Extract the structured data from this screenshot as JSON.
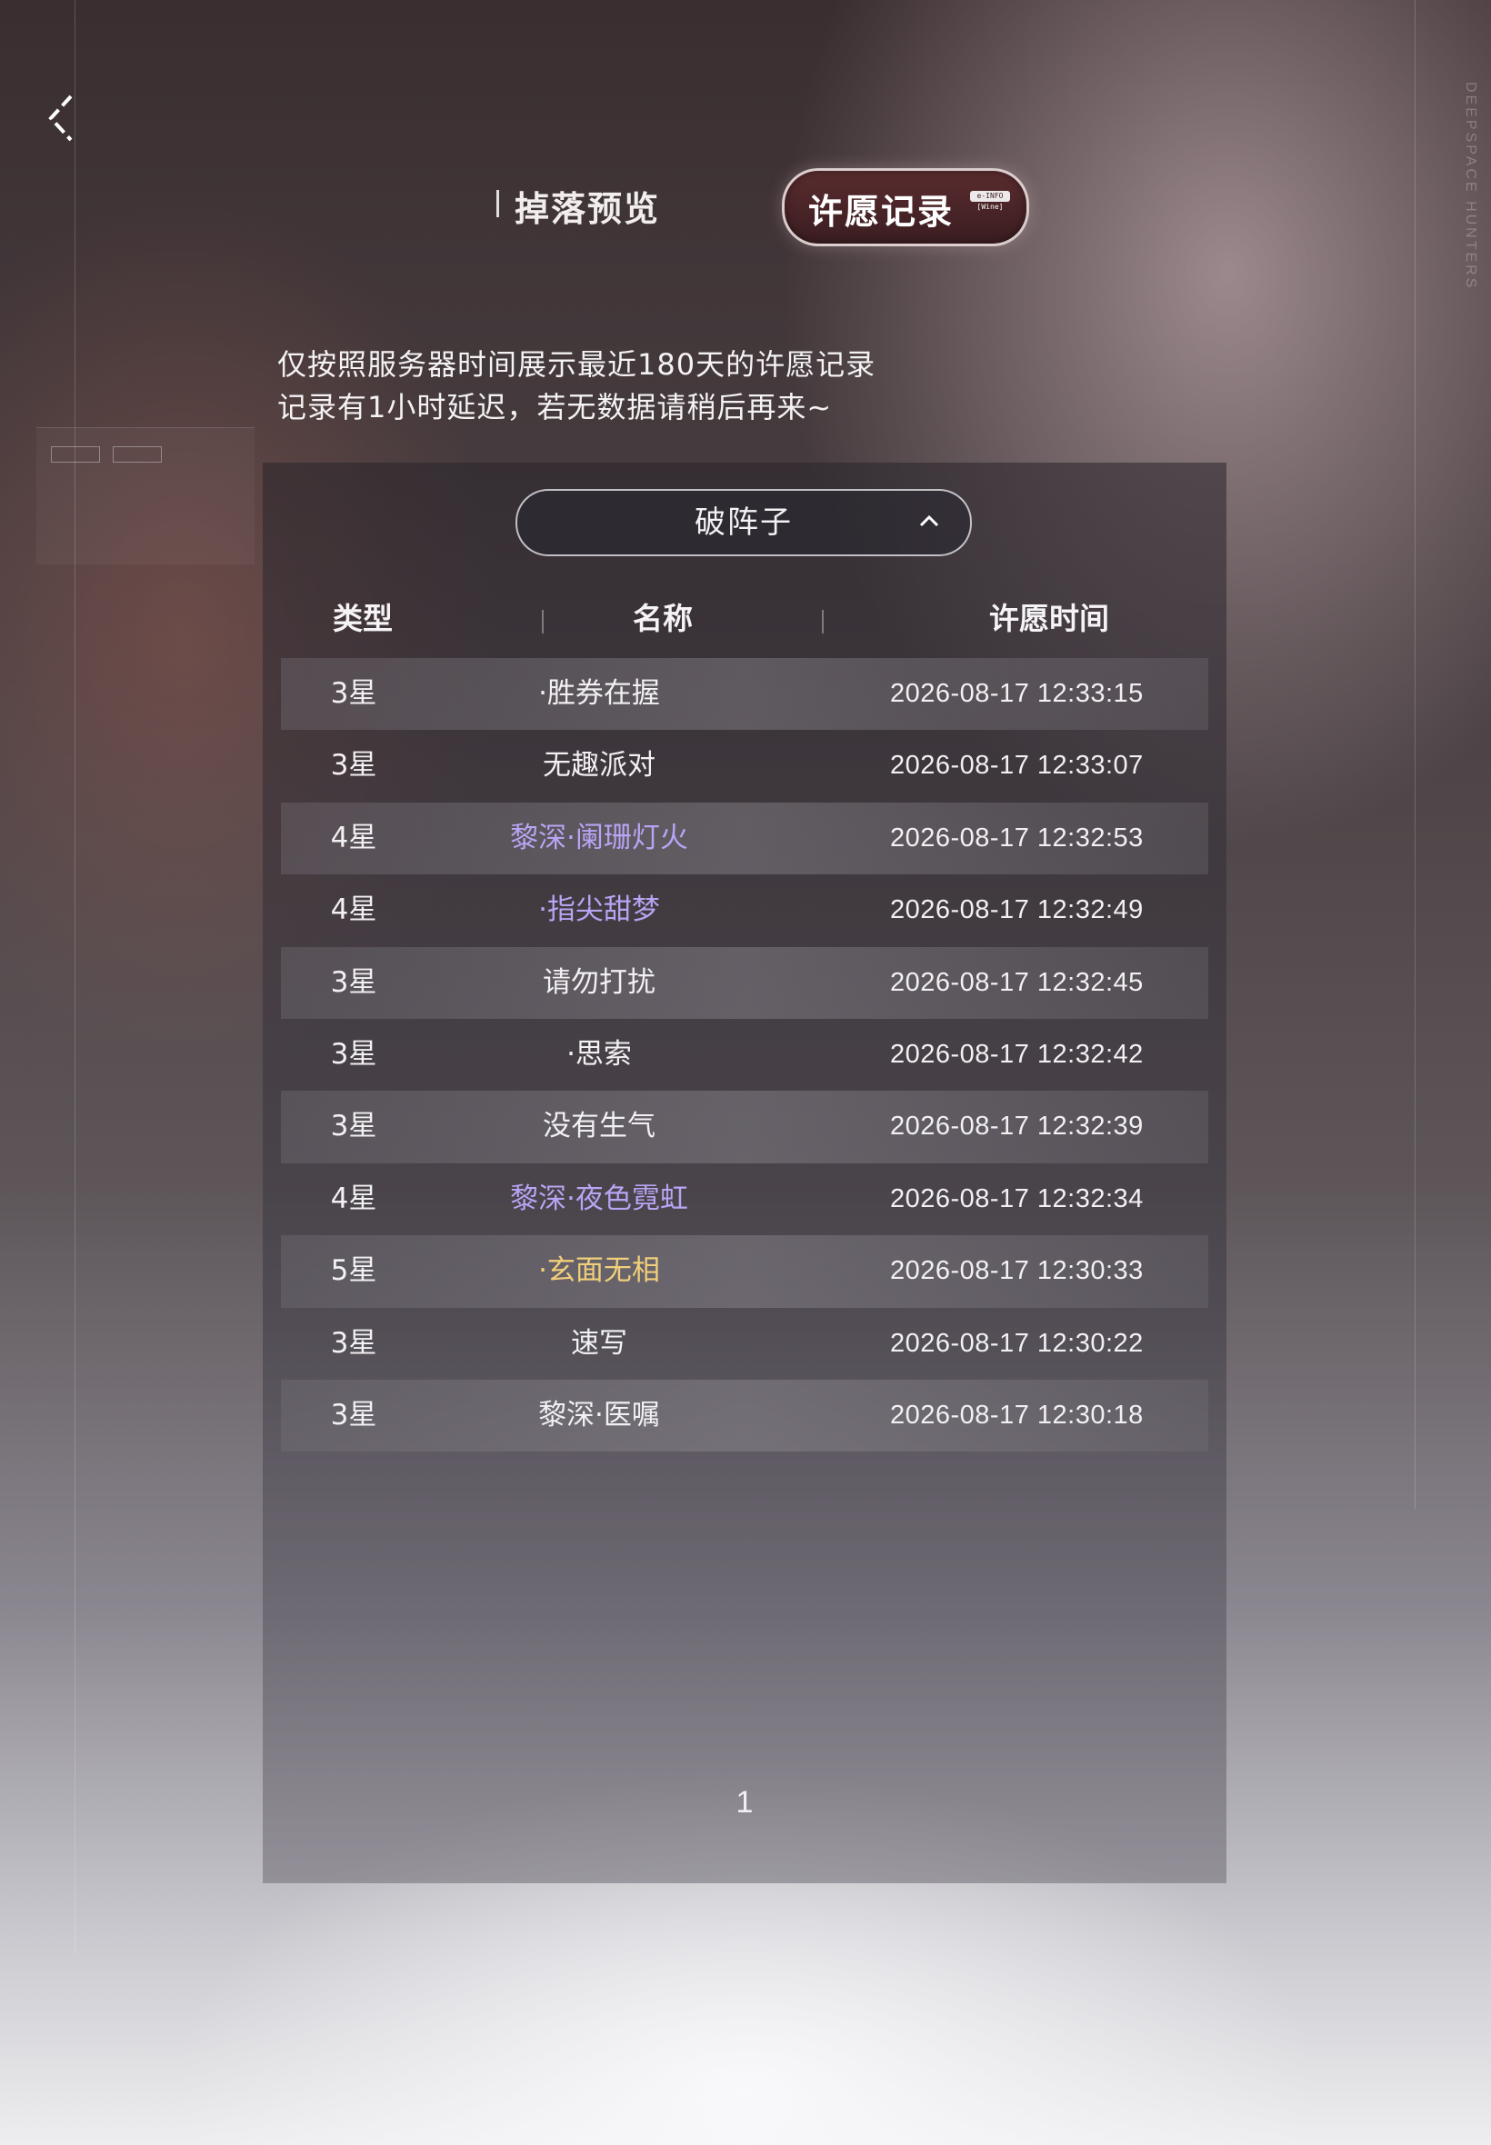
{
  "header": {
    "back_icon": "chevron-left-icon",
    "deco_text": "DEEPSPACE HUNTERS"
  },
  "tabs": {
    "drop_preview": "掉落预览",
    "wish_record": "许愿记录",
    "wish_badge_top": "e-INFO",
    "wish_badge_bottom": "[Wine]"
  },
  "notice": {
    "line1": "仅按照服务器时间展示最近180天的许愿记录",
    "line2": "记录有1小时延迟，若无数据请稍后再来~"
  },
  "pool_select": {
    "selected": "破阵子",
    "icon": "chevron-up-icon"
  },
  "table": {
    "headers": [
      "类型",
      "名称",
      "许愿时间"
    ],
    "rows": [
      {
        "type": "3星",
        "name": "·胜券在握",
        "time": "2026-08-17 12:33:15"
      },
      {
        "type": "3星",
        "name": "无趣派对",
        "time": "2026-08-17 12:33:07"
      },
      {
        "type": "4星",
        "name": "黎深·阑珊灯火",
        "time": "2026-08-17 12:32:53"
      },
      {
        "type": "4星",
        "name": "·指尖甜梦",
        "time": "2026-08-17 12:32:49"
      },
      {
        "type": "3星",
        "name": "请勿打扰",
        "time": "2026-08-17 12:32:45"
      },
      {
        "type": "3星",
        "name": "·思索",
        "time": "2026-08-17 12:32:42"
      },
      {
        "type": "3星",
        "name": "没有生气",
        "time": "2026-08-17 12:32:39"
      },
      {
        "type": "4星",
        "name": "黎深·夜色霓虹",
        "time": "2026-08-17 12:32:34"
      },
      {
        "type": "5星",
        "name": "·玄面无相",
        "time": "2026-08-17 12:30:33"
      },
      {
        "type": "3星",
        "name": "速写",
        "time": "2026-08-17 12:30:22"
      },
      {
        "type": "3星",
        "name": "黎深·医嘱",
        "time": "2026-08-17 12:30:18"
      }
    ]
  },
  "pagination": {
    "current_page": "1"
  },
  "colors": {
    "star4": "#b9a4f4",
    "star5": "#f1cf7a",
    "tab_active_bg": "#4a2528"
  }
}
